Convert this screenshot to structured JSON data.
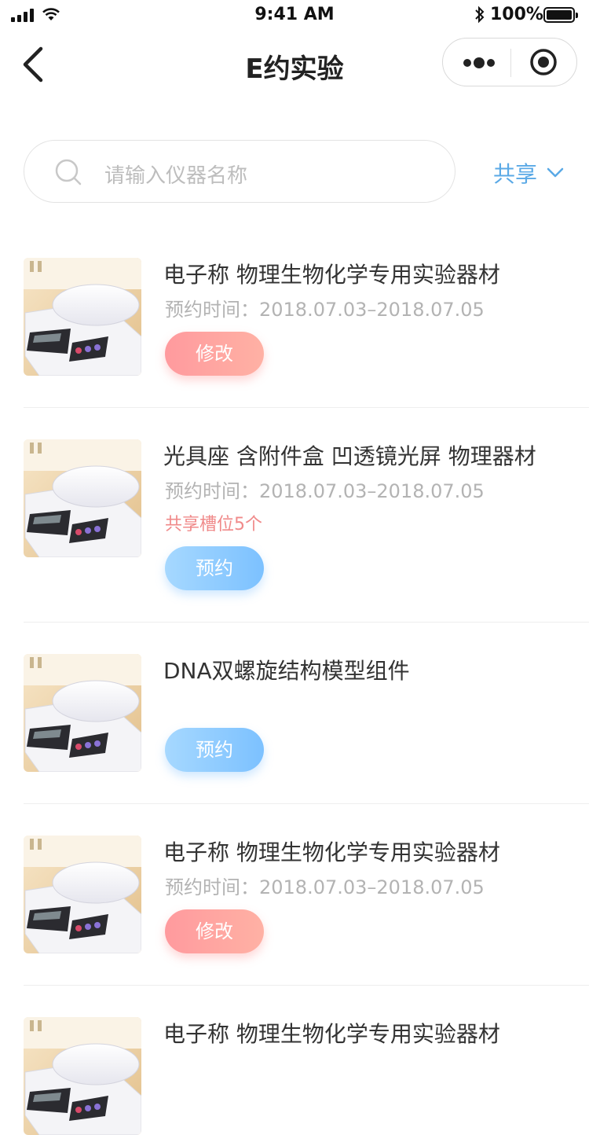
{
  "status_bar": {
    "time": "9:41 AM",
    "battery": "100%"
  },
  "nav": {
    "title": "E约实验"
  },
  "search": {
    "placeholder": "请输入仪器名称"
  },
  "filter": {
    "label": "共享"
  },
  "colors": {
    "accent_blue": "#5aa9e6",
    "pink": "#ff9a9e",
    "slot_red": "#f08a8a"
  },
  "items": [
    {
      "title": "电子称 物理生物化学专用实验器材",
      "time": "预约时间：2018.07.03–2018.07.05",
      "slot": "",
      "button": "修改",
      "button_style": "pink"
    },
    {
      "title": "光具座 含附件盒 凹透镜光屏 物理器材",
      "time": "预约时间：2018.07.03–2018.07.05",
      "slot": "共享槽位5个",
      "button": "预约",
      "button_style": "blue"
    },
    {
      "title": "DNA双螺旋结构模型组件",
      "time": "",
      "slot": "",
      "button": "预约",
      "button_style": "blue"
    },
    {
      "title": "电子称 物理生物化学专用实验器材",
      "time": "预约时间：2018.07.03–2018.07.05",
      "slot": "",
      "button": "修改",
      "button_style": "pink"
    },
    {
      "title": "电子称 物理生物化学专用实验器材",
      "time": "",
      "slot": "",
      "button": "",
      "button_style": ""
    }
  ]
}
